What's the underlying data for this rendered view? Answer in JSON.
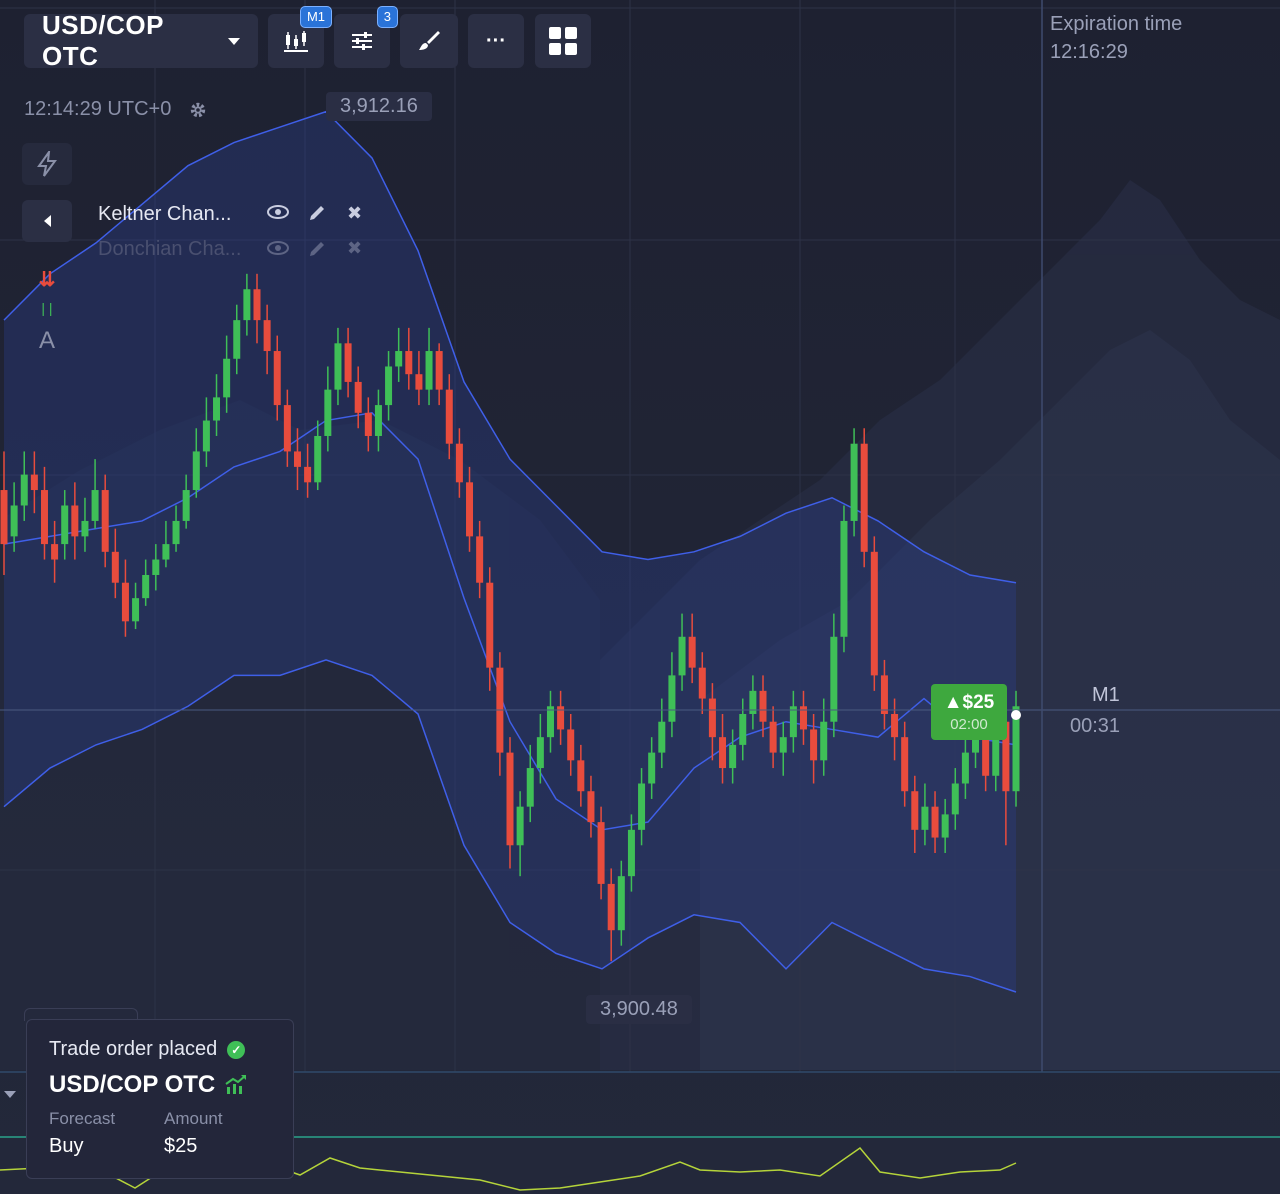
{
  "toolbar": {
    "pair": "USD/COP OTC",
    "timeframe_badge": "M1",
    "indicators_badge": "3",
    "more_label": "···"
  },
  "clock": {
    "time": "12:14:29 UTC+0"
  },
  "indicators": [
    {
      "name": "Keltner Chan...",
      "active": true
    },
    {
      "name": "Donchian Cha...",
      "active": false
    }
  ],
  "side_tools": {
    "text_tool": "A"
  },
  "price_labels": {
    "high": "3,912.16",
    "low": "3,900.48"
  },
  "expiration": {
    "label": "Expiration time",
    "time": "12:16:29"
  },
  "timer": {
    "timeframe": "M1",
    "countdown": "00:31"
  },
  "trade_tag": {
    "amount": "▲$25",
    "time": "02:00"
  },
  "toast": {
    "title": "Trade order placed",
    "pair": "USD/COP OTC",
    "forecast_label": "Forecast",
    "amount_label": "Amount",
    "forecast_value": "Buy",
    "amount_value": "$25"
  },
  "colors": {
    "up": "#3fbf57",
    "down": "#e84c3d",
    "band": "#3f5fe8",
    "accent": "#2a73d8"
  },
  "chart_data": {
    "type": "candlestick",
    "ylim": [
      3900.48,
      3912.16
    ],
    "candles": [
      [
        3907.2,
        3906.5,
        3906.1,
        3907.7
      ],
      [
        3906.6,
        3907.0,
        3906.4,
        3907.3
      ],
      [
        3907.0,
        3907.4,
        3906.8,
        3907.7
      ],
      [
        3907.4,
        3907.2,
        3906.9,
        3907.7
      ],
      [
        3907.2,
        3906.5,
        3906.3,
        3907.5
      ],
      [
        3906.5,
        3906.3,
        3906.0,
        3906.8
      ],
      [
        3906.5,
        3907.0,
        3906.3,
        3907.2
      ],
      [
        3907.0,
        3906.6,
        3906.3,
        3907.3
      ],
      [
        3906.6,
        3906.8,
        3906.4,
        3907.1
      ],
      [
        3906.8,
        3907.2,
        3906.7,
        3907.6
      ],
      [
        3907.2,
        3906.4,
        3906.2,
        3907.4
      ],
      [
        3906.4,
        3906.0,
        3905.8,
        3906.7
      ],
      [
        3906.0,
        3905.5,
        3905.3,
        3906.3
      ],
      [
        3905.5,
        3905.8,
        3905.4,
        3906.0
      ],
      [
        3905.8,
        3906.1,
        3905.7,
        3906.3
      ],
      [
        3906.1,
        3906.3,
        3905.9,
        3906.5
      ],
      [
        3906.3,
        3906.5,
        3906.2,
        3906.8
      ],
      [
        3906.5,
        3906.8,
        3906.4,
        3907.0
      ],
      [
        3906.8,
        3907.2,
        3906.7,
        3907.4
      ],
      [
        3907.2,
        3907.7,
        3907.1,
        3908.0
      ],
      [
        3907.7,
        3908.1,
        3907.5,
        3908.4
      ],
      [
        3908.1,
        3908.4,
        3907.9,
        3908.7
      ],
      [
        3908.4,
        3908.9,
        3908.2,
        3909.2
      ],
      [
        3908.9,
        3909.4,
        3908.7,
        3909.6
      ],
      [
        3909.4,
        3909.8,
        3909.2,
        3910.0
      ],
      [
        3909.8,
        3909.4,
        3909.1,
        3910.0
      ],
      [
        3909.4,
        3909.0,
        3908.7,
        3909.6
      ],
      [
        3909.0,
        3908.3,
        3908.1,
        3909.2
      ],
      [
        3908.3,
        3907.7,
        3907.5,
        3908.5
      ],
      [
        3907.7,
        3907.5,
        3907.2,
        3908.0
      ],
      [
        3907.5,
        3907.3,
        3907.1,
        3907.8
      ],
      [
        3907.3,
        3907.9,
        3907.2,
        3908.1
      ],
      [
        3907.9,
        3908.5,
        3907.7,
        3908.8
      ],
      [
        3908.5,
        3909.1,
        3908.3,
        3909.3
      ],
      [
        3909.1,
        3908.6,
        3908.4,
        3909.3
      ],
      [
        3908.6,
        3908.2,
        3908.0,
        3908.8
      ],
      [
        3908.2,
        3907.9,
        3907.7,
        3908.4
      ],
      [
        3907.9,
        3908.3,
        3907.7,
        3908.5
      ],
      [
        3908.3,
        3908.8,
        3908.1,
        3909.0
      ],
      [
        3908.8,
        3909.0,
        3908.6,
        3909.3
      ],
      [
        3909.0,
        3908.7,
        3908.5,
        3909.3
      ],
      [
        3908.7,
        3908.5,
        3908.3,
        3909.0
      ],
      [
        3908.5,
        3909.0,
        3908.3,
        3909.3
      ],
      [
        3909.0,
        3908.5,
        3908.3,
        3909.1
      ],
      [
        3908.5,
        3907.8,
        3907.6,
        3908.7
      ],
      [
        3907.8,
        3907.3,
        3907.1,
        3908.0
      ],
      [
        3907.3,
        3906.6,
        3906.4,
        3907.5
      ],
      [
        3906.6,
        3906.0,
        3905.8,
        3906.8
      ],
      [
        3906.0,
        3904.9,
        3904.6,
        3906.2
      ],
      [
        3904.9,
        3903.8,
        3903.5,
        3905.1
      ],
      [
        3903.8,
        3902.6,
        3902.3,
        3904.0
      ],
      [
        3902.6,
        3903.1,
        3902.2,
        3903.3
      ],
      [
        3903.1,
        3903.6,
        3902.9,
        3903.9
      ],
      [
        3903.6,
        3904.0,
        3903.4,
        3904.3
      ],
      [
        3904.0,
        3904.4,
        3903.8,
        3904.6
      ],
      [
        3904.4,
        3904.1,
        3903.9,
        3904.6
      ],
      [
        3904.1,
        3903.7,
        3903.5,
        3904.3
      ],
      [
        3903.7,
        3903.3,
        3903.1,
        3903.9
      ],
      [
        3903.3,
        3902.9,
        3902.7,
        3903.5
      ],
      [
        3902.9,
        3902.1,
        3901.9,
        3903.1
      ],
      [
        3902.1,
        3901.5,
        3901.1,
        3902.3
      ],
      [
        3901.5,
        3902.2,
        3901.3,
        3902.4
      ],
      [
        3902.2,
        3902.8,
        3902.0,
        3903.0
      ],
      [
        3902.8,
        3903.4,
        3902.6,
        3903.6
      ],
      [
        3903.4,
        3903.8,
        3903.2,
        3904.0
      ],
      [
        3903.8,
        3904.2,
        3903.6,
        3904.5
      ],
      [
        3904.2,
        3904.8,
        3904.0,
        3905.1
      ],
      [
        3904.8,
        3905.3,
        3904.6,
        3905.6
      ],
      [
        3905.3,
        3904.9,
        3904.7,
        3905.6
      ],
      [
        3904.9,
        3904.5,
        3904.3,
        3905.1
      ],
      [
        3904.5,
        3904.0,
        3903.7,
        3904.7
      ],
      [
        3904.0,
        3903.6,
        3903.4,
        3904.3
      ],
      [
        3903.6,
        3903.9,
        3903.4,
        3904.1
      ],
      [
        3903.9,
        3904.3,
        3903.7,
        3904.5
      ],
      [
        3904.3,
        3904.6,
        3904.1,
        3904.8
      ],
      [
        3904.6,
        3904.2,
        3904.0,
        3904.8
      ],
      [
        3904.2,
        3903.8,
        3903.6,
        3904.4
      ],
      [
        3903.8,
        3904.0,
        3903.5,
        3904.2
      ],
      [
        3904.0,
        3904.4,
        3903.8,
        3904.6
      ],
      [
        3904.4,
        3904.1,
        3903.9,
        3904.6
      ],
      [
        3904.1,
        3903.7,
        3903.4,
        3904.3
      ],
      [
        3903.7,
        3904.2,
        3903.5,
        3904.5
      ],
      [
        3904.2,
        3905.3,
        3904.0,
        3905.6
      ],
      [
        3905.3,
        3906.8,
        3905.1,
        3907.0
      ],
      [
        3906.8,
        3907.8,
        3906.6,
        3908.0
      ],
      [
        3907.8,
        3906.4,
        3906.2,
        3908.0
      ],
      [
        3906.4,
        3904.8,
        3904.6,
        3906.6
      ],
      [
        3904.8,
        3904.3,
        3904.1,
        3905.0
      ],
      [
        3904.3,
        3904.0,
        3903.7,
        3904.5
      ],
      [
        3904.0,
        3903.3,
        3903.1,
        3904.2
      ],
      [
        3903.3,
        3902.8,
        3902.5,
        3903.5
      ],
      [
        3902.8,
        3903.1,
        3902.6,
        3903.4
      ],
      [
        3903.1,
        3902.7,
        3902.5,
        3903.3
      ],
      [
        3902.7,
        3903.0,
        3902.5,
        3903.2
      ],
      [
        3903.0,
        3903.4,
        3902.8,
        3903.6
      ],
      [
        3903.4,
        3903.8,
        3903.2,
        3904.0
      ],
      [
        3903.8,
        3904.0,
        3903.6,
        3904.3
      ],
      [
        3904.0,
        3903.5,
        3903.3,
        3904.2
      ],
      [
        3903.5,
        3904.2,
        3903.3,
        3904.3
      ],
      [
        3904.2,
        3903.3,
        3902.6,
        3904.4
      ],
      [
        3903.3,
        3904.4,
        3903.1,
        3904.6
      ]
    ],
    "keltner_upper": [
      3909.4,
      3910.0,
      3910.4,
      3910.9,
      3911.4,
      3911.7,
      3911.9,
      3912.1,
      3911.5,
      3910.3,
      3908.6,
      3907.6,
      3907.0,
      3906.4,
      3906.3,
      3906.4,
      3906.6,
      3906.9,
      3907.1,
      3906.8,
      3906.4,
      3906.1,
      3906.0
    ],
    "keltner_mid": [
      3906.5,
      3906.6,
      3906.7,
      3906.8,
      3907.1,
      3907.5,
      3907.7,
      3908.1,
      3908.2,
      3907.6,
      3905.8,
      3904.2,
      3903.2,
      3902.8,
      3902.9,
      3903.6,
      3904.0,
      3904.2,
      3904.1,
      3904.0,
      3904.5,
      3904.0,
      3903.9
    ],
    "keltner_lower": [
      3903.1,
      3903.6,
      3903.9,
      3904.1,
      3904.4,
      3904.8,
      3904.8,
      3905.0,
      3904.8,
      3904.3,
      3902.6,
      3901.6,
      3901.2,
      3901.0,
      3901.4,
      3901.7,
      3901.6,
      3901.0,
      3901.6,
      3901.3,
      3901.0,
      3900.9,
      3900.7
    ]
  }
}
